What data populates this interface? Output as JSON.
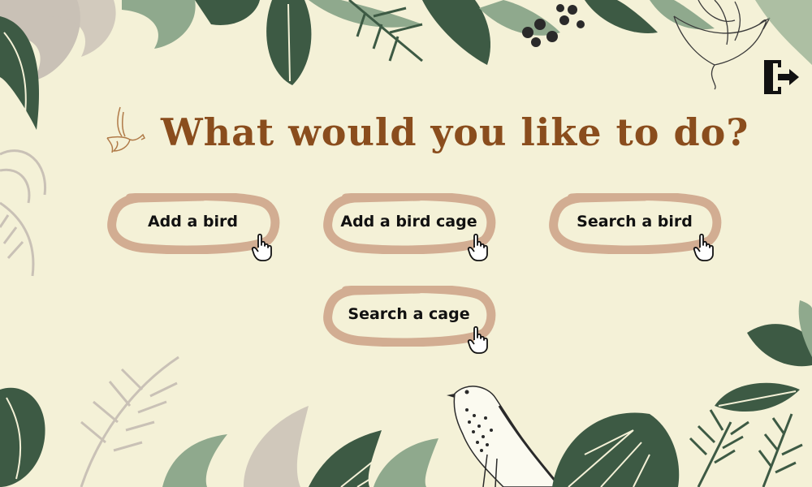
{
  "page": {
    "title": "What would you like to do?"
  },
  "actions": [
    {
      "label": "Add a bird"
    },
    {
      "label": "Add a bird cage"
    },
    {
      "label": "Search a bird"
    },
    {
      "label": "Search a cage"
    }
  ],
  "icons": {
    "logout": "logout-door-icon",
    "pointer": "hand-pointer-icon",
    "title_bird": "dove-icon"
  },
  "colors": {
    "background": "#f4f1d7",
    "title": "#8a4d1d",
    "button_stroke": "#d2ad92",
    "leaf_dark": "#3d5a44",
    "leaf_sage": "#8fa98d",
    "leaf_grey": "#c9c1b6"
  }
}
